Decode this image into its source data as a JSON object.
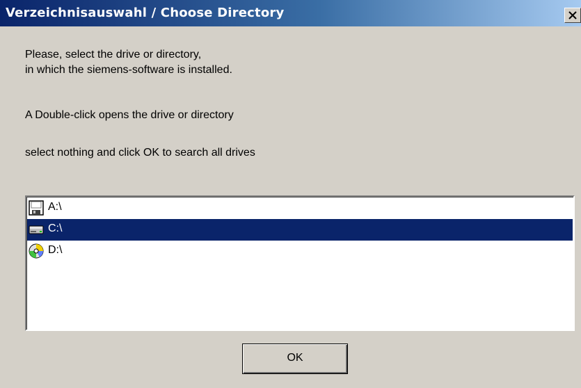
{
  "window": {
    "title": "Verzeichnisauswahl / Choose Directory",
    "close_label": "×"
  },
  "instructions": {
    "line1": "Please, select the drive or directory,",
    "line2": "in which the siemens-software is installed.",
    "line3": "A Double-click opens the drive or directory",
    "line4": "select nothing and click OK to search all drives"
  },
  "drives": [
    {
      "label": "A:\\",
      "icon": "floppy-drive-icon",
      "selected": false
    },
    {
      "label": "C:\\",
      "icon": "hard-drive-icon",
      "selected": true
    },
    {
      "label": "D:\\",
      "icon": "cd-drive-icon",
      "selected": false
    }
  ],
  "buttons": {
    "ok_label": "OK"
  },
  "colors": {
    "title_gradient_start": "#0a246a",
    "title_gradient_end": "#a6caf0",
    "selection": "#0a246a",
    "dialog_bg": "#d4d0c8"
  }
}
